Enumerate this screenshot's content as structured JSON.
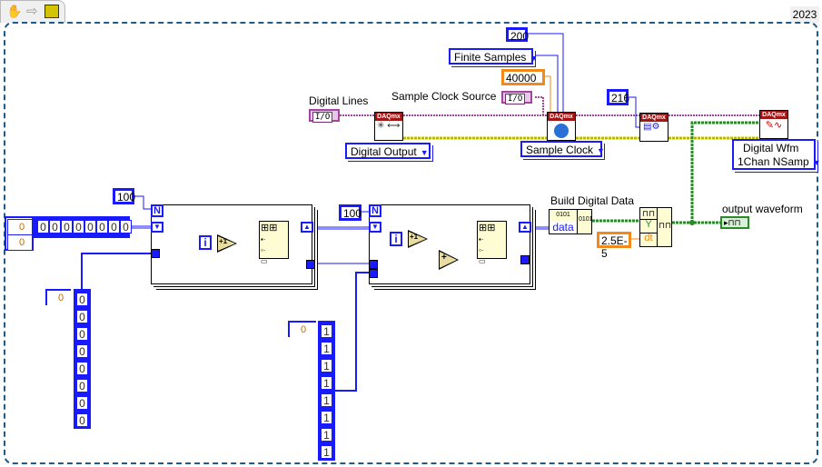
{
  "toolbar": {
    "icons": [
      "hand-tool-icon",
      "run-arrow-icon",
      "vi-icon"
    ]
  },
  "version_label": "2023",
  "constants": {
    "samples_per_channel": "200",
    "sample_mode": "Finite Samples",
    "rate": "40000",
    "buffer_size": "216",
    "dt": "2.5E-5",
    "loop1_count": "100",
    "loop2_count": "100"
  },
  "labels": {
    "digital_lines": "Digital Lines",
    "sample_clock_source": "Sample Clock Source",
    "build_digital_data": "Build Digital Data",
    "output_waveform": "output waveform"
  },
  "io_constants": {
    "digital_lines": "I/O",
    "sample_clock_source": "I/O"
  },
  "daqmx_nodes": [
    {
      "name": "DAQmx Create Virtual Channel",
      "header": "DAQmx",
      "selector": "Digital Output"
    },
    {
      "name": "DAQmx Timing",
      "header": "DAQmx",
      "selector": "Sample Clock"
    },
    {
      "name": "DAQmx Configure Output Buffer",
      "header": "DAQmx"
    },
    {
      "name": "DAQmx Write",
      "header": "DAQmx",
      "selector_line1": "Digital Wfm",
      "selector_line2": "1Chan NSamp"
    }
  ],
  "loop_terms": {
    "n": "N",
    "i": "i",
    "increment": "+1",
    "add": "+"
  },
  "build_digital_data": {
    "top": "0101",
    "data_label": "data",
    "out": "0101"
  },
  "build_waveform": {
    "y_label": "Y",
    "dt_label": "dt"
  },
  "array_2d_const": {
    "index_row": "0",
    "index_col": "0",
    "values": [
      "0",
      "0",
      "0",
      "0",
      "0",
      "0",
      "0",
      "0"
    ]
  },
  "array_zeros": {
    "index": "0",
    "values": [
      "0",
      "0",
      "0",
      "0",
      "0",
      "0",
      "0",
      "0"
    ]
  },
  "array_ones": {
    "index": "0",
    "values": [
      "1",
      "1",
      "1",
      "1",
      "1",
      "1",
      "1",
      "1"
    ]
  },
  "colors": {
    "int_wire": "#1a1aff",
    "dbl_wire": "#f28a1b",
    "task_wire": "#a2469e",
    "error_wire": "#c8c800",
    "waveform_wire": "#2a8a2a",
    "daqmx_header": "#a31515",
    "frame": "#1f5b89"
  }
}
